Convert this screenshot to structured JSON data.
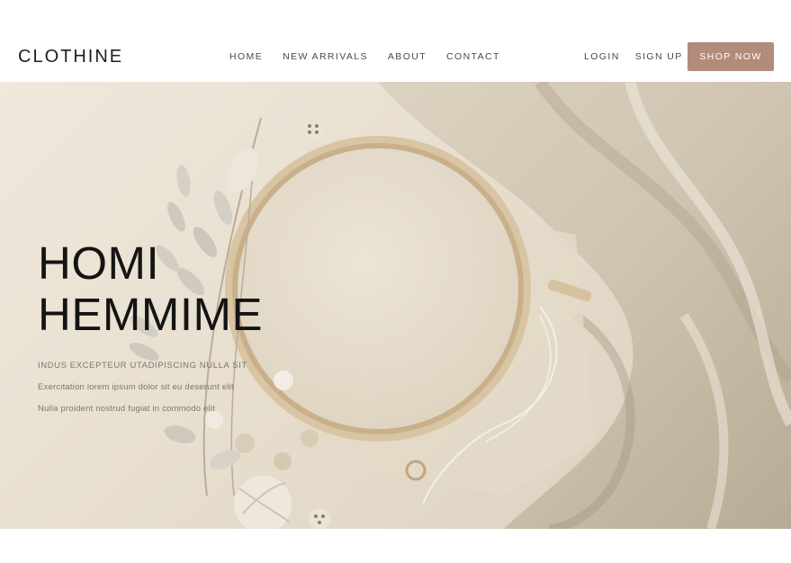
{
  "brand": {
    "logo": "CLOTHINE",
    "accent": "#b38b7a"
  },
  "nav": {
    "items": [
      {
        "label": "HOME"
      },
      {
        "label": "NEW ARRIVALS"
      },
      {
        "label": "ABOUT"
      },
      {
        "label": "CONTACT"
      }
    ]
  },
  "auth": {
    "login": "LOGIN",
    "signup": "SIGN UP"
  },
  "cta": {
    "shop_now": "SHOP NOW"
  },
  "hero": {
    "title_line1": "HOMI",
    "title_line2": "HEMMIME",
    "line1": "INDUS EXCEPTEUR UTADIPISCING NULLA SIT",
    "line2": "Exercitation lorem ipsum dolor sit eu deserunt elit",
    "line3": "Nulla proident nostrud fugiat in commodo elit"
  }
}
